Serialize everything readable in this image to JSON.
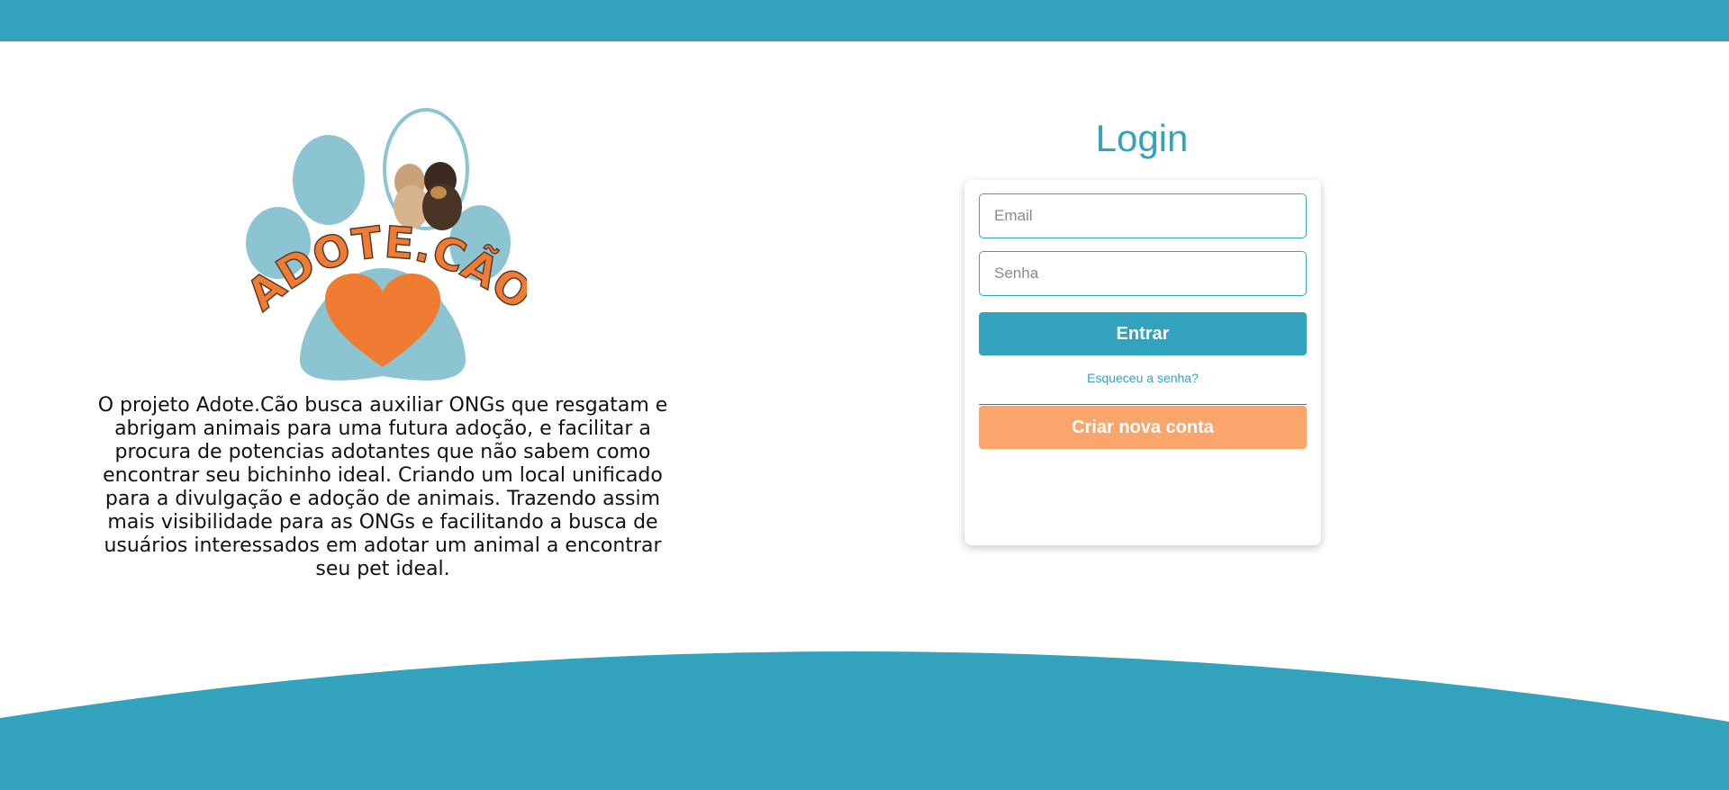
{
  "colors": {
    "primary": "#33a2bd",
    "secondary": "#f9a56b",
    "logo_paw": "#8cc4d2",
    "logo_heart": "#ef7c32"
  },
  "logo": {
    "text": "ADOTE.CÃO"
  },
  "description": "O projeto Adote.Cão busca auxiliar ONGs que resgatam e abrigam animais para uma futura adoção, e facilitar a procura de potencias adotantes que não sabem como encontrar seu bichinho ideal. Criando um local unificado para a divulgação e adoção de animais. Trazendo assim mais visibilidade para as ONGs e facilitando a busca de usuários interessados em adotar um animal a encontrar seu pet ideal.",
  "login": {
    "title": "Login",
    "email_placeholder": "Email",
    "password_placeholder": "Senha",
    "submit_label": "Entrar",
    "forgot_label": "Esqueceu a senha?",
    "create_label": "Criar nova conta"
  }
}
